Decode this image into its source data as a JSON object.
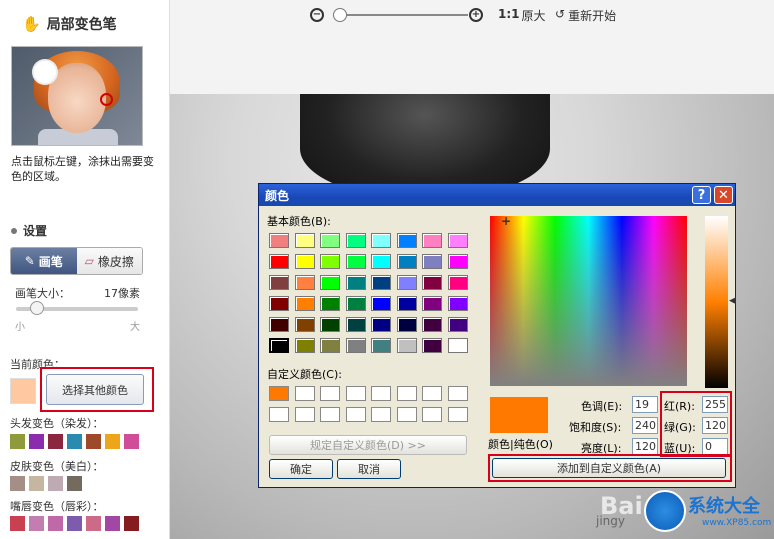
{
  "sidebar": {
    "title": "局部变色笔",
    "hint": "点击鼠标左键，涂抹出需要变色的区域。",
    "settings_label": "设置",
    "tab_brush": "画笔",
    "tab_eraser": "橡皮擦",
    "brush_size_label": "画笔大小：",
    "brush_size_value": "17像素",
    "slider_min": "小",
    "slider_max": "大",
    "current_color_label": "当前颜色：",
    "current_color": "#ffc8a0",
    "other_color_button": "选择其他颜色",
    "hair_label": "头发变色（染发）：",
    "hair_colors": [
      "#8f9a3c",
      "#8b2caf",
      "#8a2640",
      "#2a8ab0",
      "#9c4a28",
      "#eda61a",
      "#cf4e97"
    ],
    "skin_label": "皮肤变色（美白）：",
    "skin_colors": [
      "#a48e86",
      "#c5b6a2",
      "#bdaab3",
      "#736c5e"
    ],
    "lip_label": "嘴唇变色（唇彩）：",
    "lip_colors": [
      "#c94150",
      "#c27db1",
      "#bf69a8",
      "#7d5cae",
      "#cc6a88",
      "#a247a4",
      "#841c20"
    ]
  },
  "toolbar": {
    "zoom_ratio": "1:1",
    "original_size": "原大",
    "restart": "重新开始"
  },
  "dialog": {
    "title": "颜色",
    "basic_colors_label": "基本颜色(B):",
    "basic_colors": [
      [
        "#f08080",
        "#ffff80",
        "#80ff80",
        "#00ff80",
        "#80ffff",
        "#0080ff",
        "#ff80c0",
        "#ff80ff"
      ],
      [
        "#ff0000",
        "#ffff00",
        "#80ff00",
        "#00ff40",
        "#00ffff",
        "#0080c0",
        "#8080c0",
        "#ff00ff"
      ],
      [
        "#804040",
        "#ff8040",
        "#00ff00",
        "#008080",
        "#004080",
        "#8080ff",
        "#800040",
        "#ff0080"
      ],
      [
        "#800000",
        "#ff8000",
        "#008000",
        "#008040",
        "#0000ff",
        "#0000a0",
        "#800080",
        "#8000ff"
      ],
      [
        "#400000",
        "#804000",
        "#004000",
        "#004040",
        "#000080",
        "#000040",
        "#400040",
        "#400080"
      ],
      [
        "#000000",
        "#808000",
        "#808040",
        "#808080",
        "#408080",
        "#c0c0c0",
        "#400040",
        "#ffffff"
      ]
    ],
    "custom_colors_label": "自定义颜色(C):",
    "custom_colors": [
      "#ff7800"
    ],
    "define_custom_button": "规定自定义颜色(D) >>",
    "ok_button": "确定",
    "cancel_button": "取消",
    "color_solid_label": "颜色|纯色(O)",
    "hue_label": "色调(E):",
    "hue_value": "19",
    "sat_label": "饱和度(S):",
    "sat_value": "240",
    "lum_label": "亮度(L):",
    "lum_value": "120",
    "red_label": "红(R):",
    "red_value": "255",
    "green_label": "绿(G):",
    "green_value": "120",
    "blue_label": "蓝(U):",
    "blue_value": "0",
    "add_custom_button": "添加到自定义颜色(A)",
    "preview_color": "#ff7800"
  },
  "watermark": {
    "brand": "系统大全",
    "site": "www.XP85.com",
    "baidu": "Bai",
    "jingyan": "jingy"
  }
}
